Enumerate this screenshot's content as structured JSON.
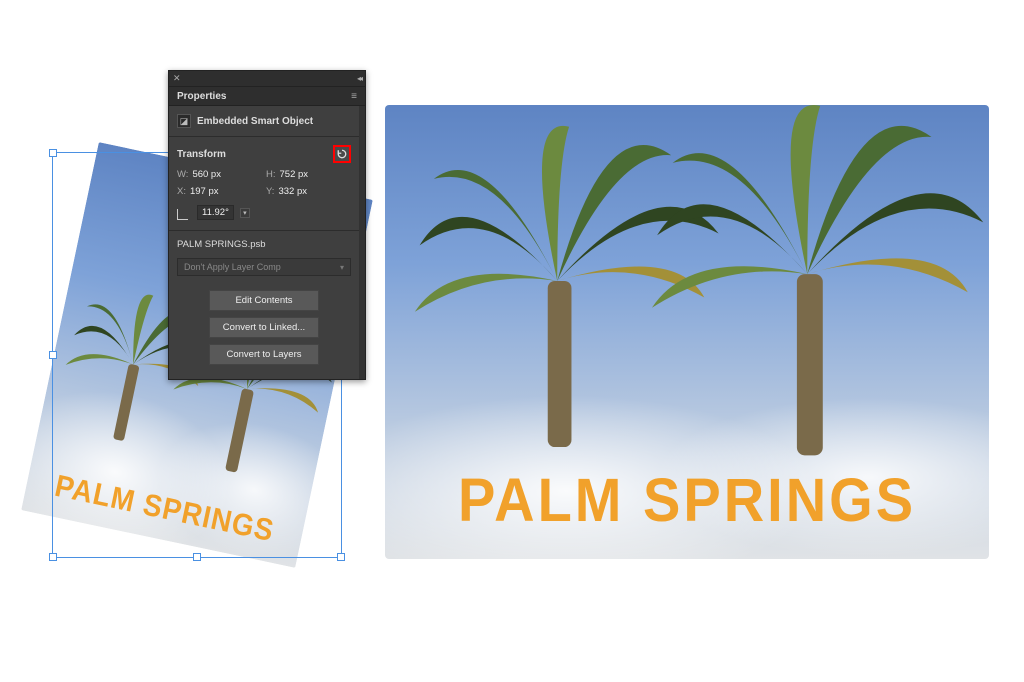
{
  "panel": {
    "title": "Properties",
    "object_type": "Embedded Smart Object",
    "transform": {
      "label": "Transform",
      "w_label": "W:",
      "w_value": "560 px",
      "h_label": "H:",
      "h_value": "752 px",
      "x_label": "X:",
      "x_value": "197 px",
      "y_label": "Y:",
      "y_value": "332 px",
      "angle_value": "11.92°"
    },
    "filename": "PALM SPRINGS.psb",
    "layer_comp_placeholder": "Don't Apply Layer Comp",
    "buttons": {
      "edit": "Edit Contents",
      "convert_linked": "Convert to Linked...",
      "convert_layers": "Convert to Layers"
    }
  },
  "artwork": {
    "title_text": "PALM SPRINGS",
    "accent_color": "#f1a12b"
  }
}
